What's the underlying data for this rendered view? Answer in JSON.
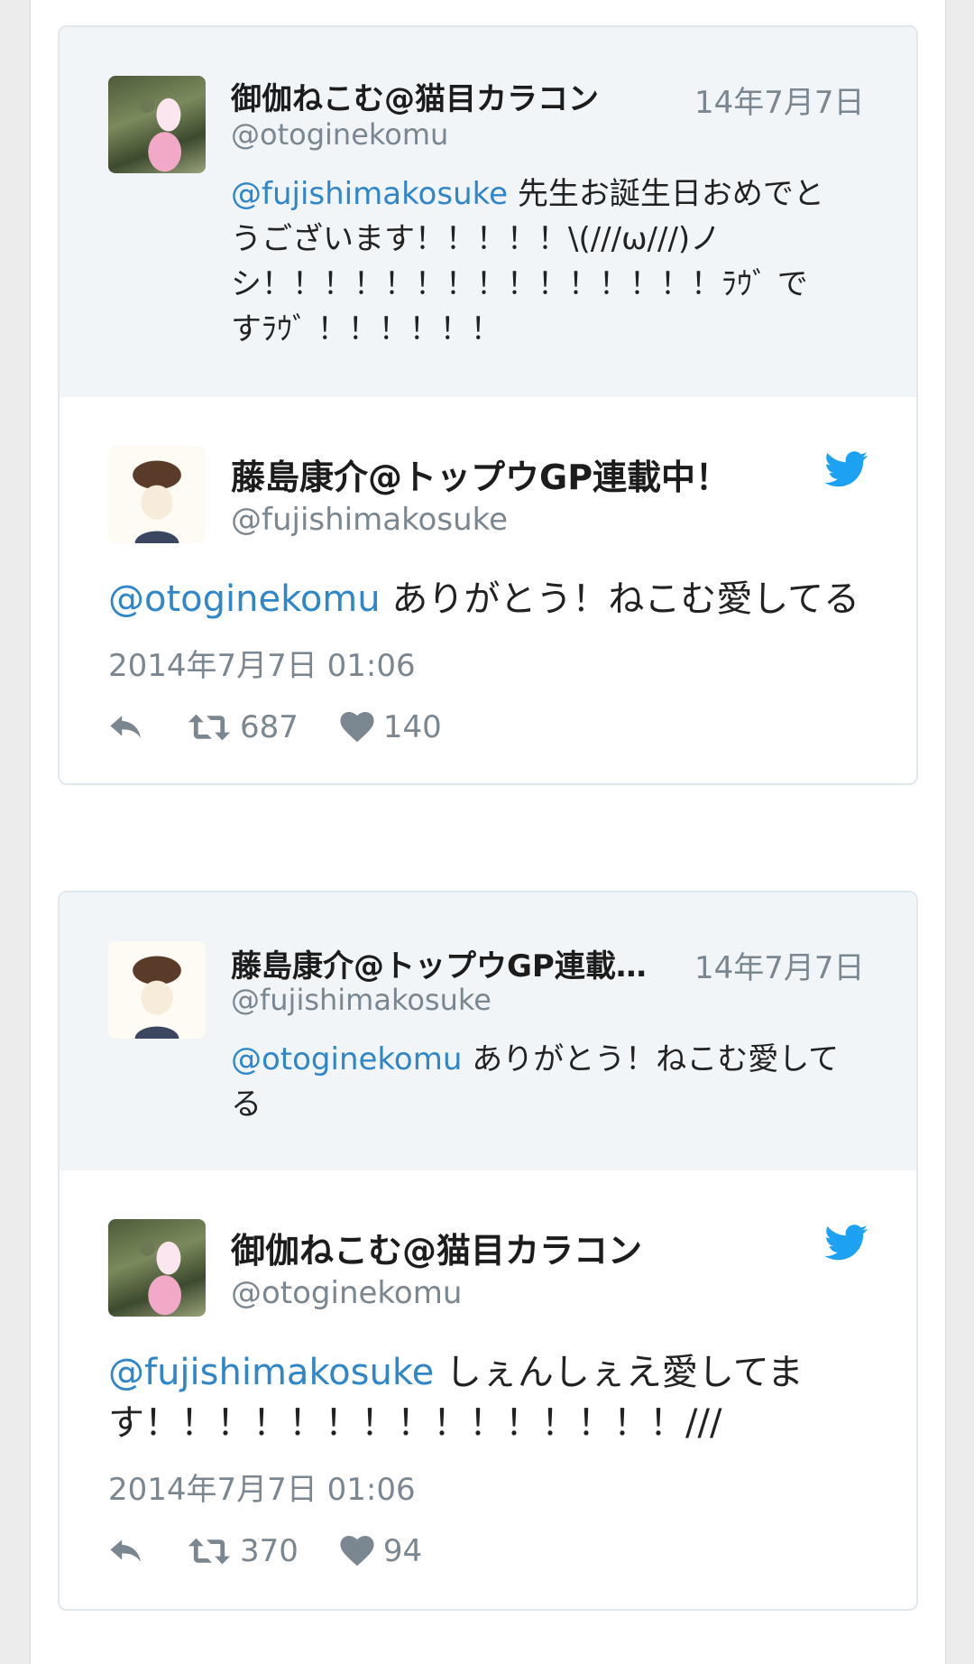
{
  "cards": [
    {
      "quoted": {
        "name": "御伽ねこむ@猫目カラコン",
        "handle": "@otoginekomu",
        "date": "14年7月7日",
        "mention": "@fujishimakosuke",
        "text_line1_rest": " 先生お誕生日おめでと",
        "text_line2": "うございます！！！！！\\(///ω///)ノ",
        "text_line3": "シ！！！！！！！！！！！！！！！ﾗｳﾞ で",
        "text_line4": "すﾗｳﾞ ！！！！！！"
      },
      "main": {
        "name": "藤島康介@トップウGP連載中！",
        "handle": "@fujishimakosuke",
        "mention": "@otoginekomu",
        "text_rest": " ありがとう！ねこむ愛してる",
        "datetime": "2014年7月7日 01:06",
        "retweets": "687",
        "likes": "140"
      }
    },
    {
      "quoted": {
        "name": "藤島康介@トップウGP連載…",
        "handle": "@fujishimakosuke",
        "date": "14年7月7日",
        "mention": "@otoginekomu",
        "text_line1_rest": " ありがとう！ねこむ愛して",
        "text_line2": "る"
      },
      "main": {
        "name": "御伽ねこむ@猫目カラコン",
        "handle": "@otoginekomu",
        "mention": "@fujishimakosuke",
        "text_line1_rest": " しぇんしぇえ愛してま",
        "text_line2": "す！！！！！！！！！！！！！！！///",
        "datetime": "2014年7月7日 01:06",
        "retweets": "370",
        "likes": "94"
      }
    }
  ],
  "colors": {
    "mention": "#2f86c9",
    "twitter_blue": "#1da1f2",
    "muted": "#7a8791"
  },
  "icons": [
    "reply-icon",
    "retweet-icon",
    "heart-icon",
    "twitter-bird-icon"
  ]
}
